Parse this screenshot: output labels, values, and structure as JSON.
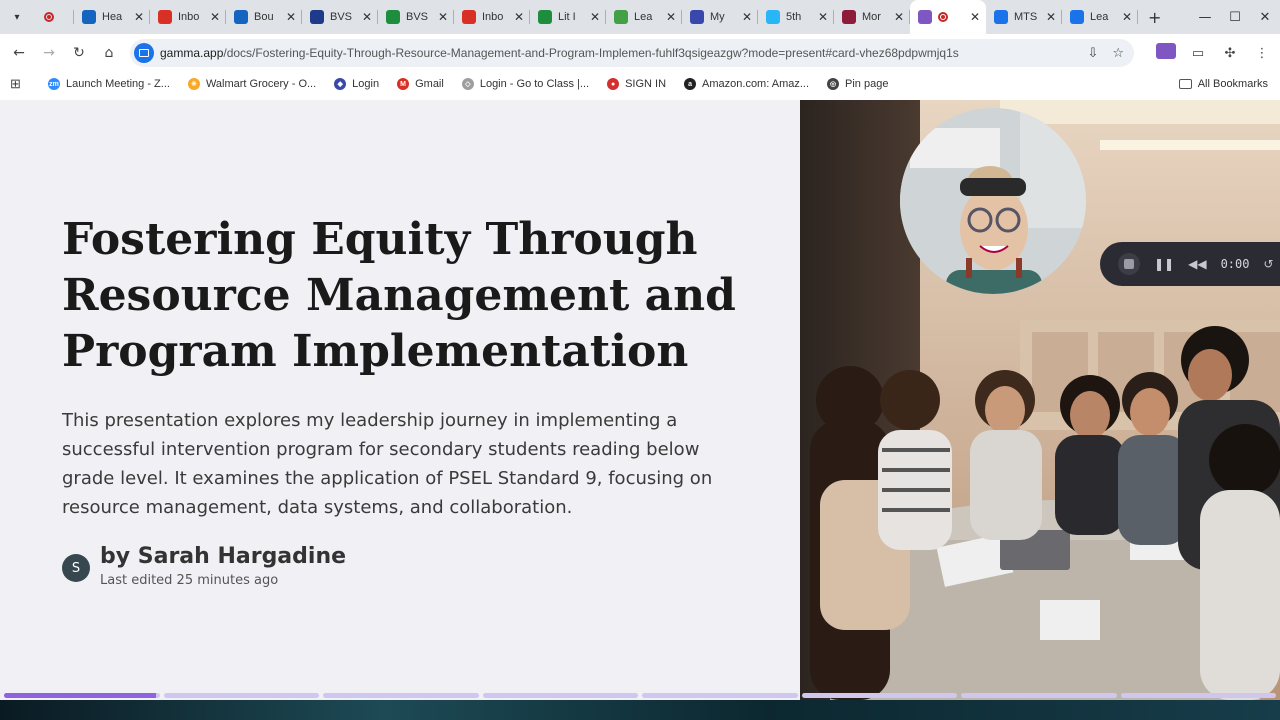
{
  "tabs": [
    {
      "title": "",
      "icon": "record-icon",
      "color": "#c62828"
    },
    {
      "title": "Hea",
      "icon": "globe-icon",
      "color": "#1565c0"
    },
    {
      "title": "Inbo",
      "icon": "gmail-icon",
      "color": "#d93025"
    },
    {
      "title": "Bou",
      "icon": "b-icon",
      "color": "#1565c0"
    },
    {
      "title": "BVS",
      "icon": "bvs-icon",
      "color": "#1e3a8a"
    },
    {
      "title": "BVS",
      "icon": "drive-icon",
      "color": "#1e8e3e"
    },
    {
      "title": "Inbo",
      "icon": "gmail-icon",
      "color": "#d93025"
    },
    {
      "title": "Lit I",
      "icon": "plus-icon",
      "color": "#1e8e3e"
    },
    {
      "title": "Lea",
      "icon": "check-icon",
      "color": "#43a047"
    },
    {
      "title": "My",
      "icon": "stack-icon",
      "color": "#3949ab"
    },
    {
      "title": "5th",
      "icon": "p-icon",
      "color": "#29b6f6"
    },
    {
      "title": "Mor",
      "icon": "shield-icon",
      "color": "#8e1b3a"
    },
    {
      "title": "",
      "icon": "gamma-icon",
      "color": "#7e57c2",
      "active": true
    },
    {
      "title": "MTS",
      "icon": "docs-icon",
      "color": "#1a73e8"
    },
    {
      "title": "Lea",
      "icon": "docs-icon",
      "color": "#1a73e8"
    }
  ],
  "url": {
    "host": "gamma.app",
    "path": "/docs/Fostering-Equity-Through-Resource-Management-and-Program-Implemen-fuhlf3qsigeazgw?mode=present#card-vhez68pdpwmjq1s"
  },
  "bookmarks": [
    {
      "label": "Launch Meeting - Z...",
      "icon": "zoom-icon",
      "color": "#2d8cff",
      "glyph": "zm"
    },
    {
      "label": "Walmart Grocery - O...",
      "icon": "walmart-icon",
      "color": "#f9a825",
      "glyph": "✳"
    },
    {
      "label": "Login",
      "icon": "login-icon",
      "color": "#3949ab",
      "glyph": "◆"
    },
    {
      "label": "Gmail",
      "icon": "gmail-icon",
      "color": "#d93025",
      "glyph": "M"
    },
    {
      "label": "Login - Go to Class |...",
      "icon": "class-icon",
      "color": "#9e9e9e",
      "glyph": "◇"
    },
    {
      "label": "SIGN IN",
      "icon": "signin-icon",
      "color": "#d32f2f",
      "glyph": "●"
    },
    {
      "label": "Amazon.com: Amaz...",
      "icon": "amazon-icon",
      "color": "#222222",
      "glyph": "a"
    },
    {
      "label": "Pin page",
      "icon": "globe-icon",
      "color": "#444444",
      "glyph": "◎"
    }
  ],
  "all_bookmarks": "All Bookmarks",
  "slide": {
    "title": "Fostering Equity Through Resource Management and Program Implementation",
    "description": "This presentation explores my leadership journey in implementing a successful intervention program for secondary students reading below grade level. It examines the application of PSEL Standard 9, focusing on resource management, data systems, and collaboration.",
    "author": "by Sarah Hargadine",
    "author_initial": "S",
    "edited": "Last edited 25 minutes ago"
  },
  "recorder": {
    "timer": "0:00"
  },
  "progress": {
    "segments": 8,
    "current_fraction": 0.98
  },
  "colors": {
    "accent": "#8e63e0",
    "track": "#cfc7ee"
  }
}
